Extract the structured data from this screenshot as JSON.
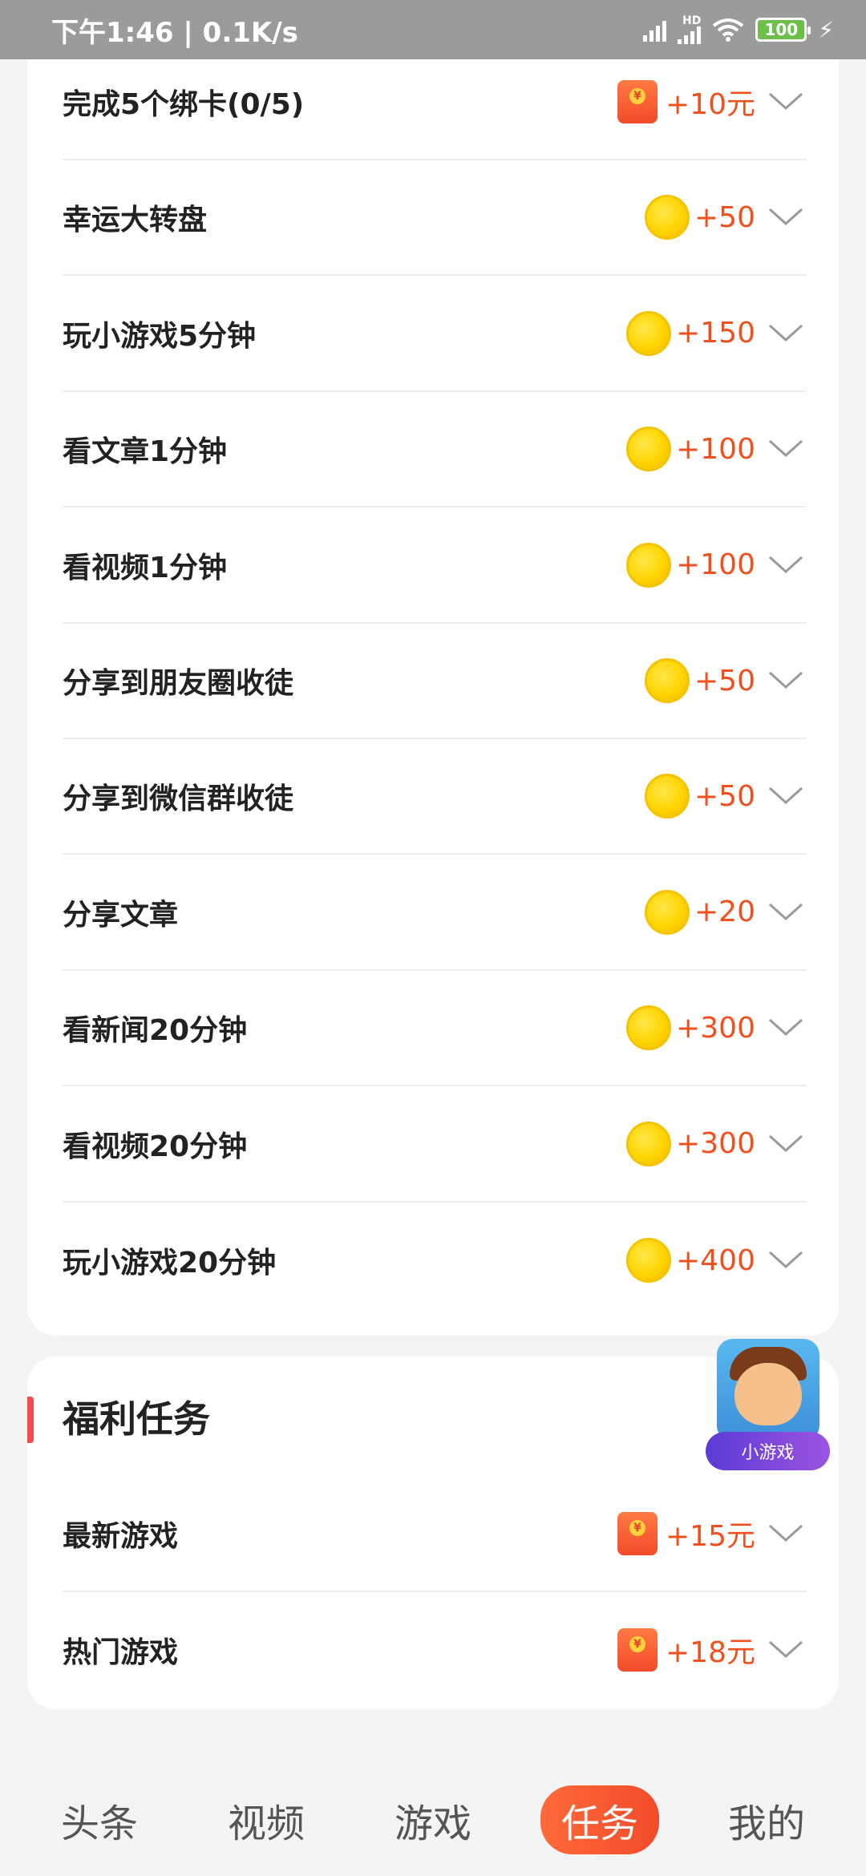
{
  "status_bar": {
    "time_speed": "下午1:46 | 0.1K/s",
    "hd": "HD",
    "battery": "100"
  },
  "tasks": [
    {
      "title": "完成5个绑卡(0/5)",
      "reward_icon": "red-packet",
      "amount": "+10元"
    },
    {
      "title": "幸运大转盘",
      "reward_icon": "coin",
      "amount": "+50"
    },
    {
      "title": "玩小游戏5分钟",
      "reward_icon": "coin",
      "amount": "+150"
    },
    {
      "title": "看文章1分钟",
      "reward_icon": "coin",
      "amount": "+100"
    },
    {
      "title": "看视频1分钟",
      "reward_icon": "coin",
      "amount": "+100"
    },
    {
      "title": "分享到朋友圈收徒",
      "reward_icon": "coin",
      "amount": "+50"
    },
    {
      "title": "分享到微信群收徒",
      "reward_icon": "coin",
      "amount": "+50"
    },
    {
      "title": "分享文章",
      "reward_icon": "coin",
      "amount": "+20"
    },
    {
      "title": "看新闻20分钟",
      "reward_icon": "coin",
      "amount": "+300"
    },
    {
      "title": "看视频20分钟",
      "reward_icon": "coin",
      "amount": "+300"
    },
    {
      "title": "玩小游戏20分钟",
      "reward_icon": "coin",
      "amount": "+400"
    }
  ],
  "welfare": {
    "title": "福利任务",
    "items": [
      {
        "title": "最新游戏",
        "reward_icon": "red-packet",
        "amount": "+15元"
      },
      {
        "title": "热门游戏",
        "reward_icon": "red-packet",
        "amount": "+18元"
      }
    ]
  },
  "float_game": {
    "label": "小游戏"
  },
  "tabs": [
    {
      "label": "头条",
      "active": false
    },
    {
      "label": "视频",
      "active": false
    },
    {
      "label": "游戏",
      "active": false
    },
    {
      "label": "任务",
      "active": true
    },
    {
      "label": "我的",
      "active": false
    }
  ],
  "colors": {
    "accent": "#f0501e",
    "coin": "#ffd400",
    "active_tab": "#f24b2a",
    "section_bar": "#f24b4b"
  }
}
